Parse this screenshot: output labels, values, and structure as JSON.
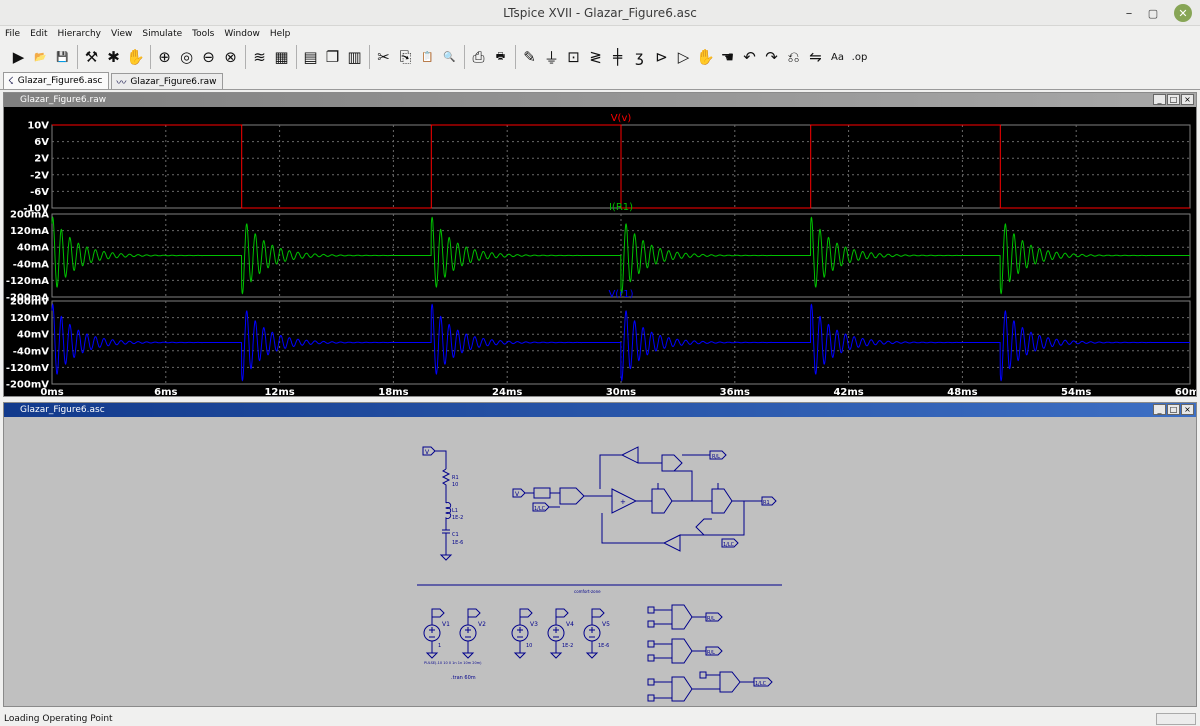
{
  "window": {
    "title": "LTspice XVII - Glazar_Figure6.asc",
    "minimize": "–",
    "maximize": "▢",
    "close": "✕"
  },
  "menu": [
    "File",
    "Edit",
    "Hierarchy",
    "View",
    "Simulate",
    "Tools",
    "Window",
    "Help"
  ],
  "toolbar": [
    {
      "icon": "run-icon",
      "glyph": "▶"
    },
    {
      "icon": "open-icon",
      "glyph": "📂"
    },
    {
      "icon": "save-icon",
      "glyph": "💾"
    },
    {
      "sep": true
    },
    {
      "icon": "control-panel-icon",
      "glyph": "⚒"
    },
    {
      "icon": "halt-icon",
      "glyph": "✱"
    },
    {
      "icon": "pan-hand-icon",
      "glyph": "✋"
    },
    {
      "sep": true
    },
    {
      "icon": "zoom-in-icon",
      "glyph": "⊕"
    },
    {
      "icon": "zoom-fit-icon",
      "glyph": "◎"
    },
    {
      "icon": "zoom-out-icon",
      "glyph": "⊖"
    },
    {
      "icon": "zoom-cancel-icon",
      "glyph": "⊗"
    },
    {
      "sep": true
    },
    {
      "icon": "autorange-icon",
      "glyph": "≋"
    },
    {
      "icon": "grid-icon",
      "glyph": "▦"
    },
    {
      "sep": true
    },
    {
      "icon": "tile-horizontal-icon",
      "glyph": "▤"
    },
    {
      "icon": "cascade-icon",
      "glyph": "❐"
    },
    {
      "icon": "tile-vertical-icon",
      "glyph": "▥"
    },
    {
      "sep": true
    },
    {
      "icon": "cut-icon",
      "glyph": "✂"
    },
    {
      "icon": "copy-icon",
      "glyph": "⎘"
    },
    {
      "icon": "paste-icon",
      "glyph": "📋"
    },
    {
      "icon": "find-icon",
      "glyph": "🔍"
    },
    {
      "sep": true
    },
    {
      "icon": "print-preview-icon",
      "glyph": "⎙"
    },
    {
      "icon": "print-icon",
      "glyph": "🖶"
    },
    {
      "sep": true
    },
    {
      "icon": "draw-wire-icon",
      "glyph": "✎"
    },
    {
      "icon": "ground-icon",
      "glyph": "⏚"
    },
    {
      "icon": "label-net-icon",
      "glyph": "⊡"
    },
    {
      "icon": "resistor-icon",
      "glyph": "≷"
    },
    {
      "icon": "capacitor-icon",
      "glyph": "╪"
    },
    {
      "icon": "inductor-icon",
      "glyph": "ʒ"
    },
    {
      "icon": "diode-icon",
      "glyph": "⊳"
    },
    {
      "icon": "component-icon",
      "glyph": "▷"
    },
    {
      "icon": "move-icon",
      "glyph": "✋"
    },
    {
      "icon": "drag-icon",
      "glyph": "☚"
    },
    {
      "icon": "undo-icon",
      "glyph": "↶"
    },
    {
      "icon": "redo-icon",
      "glyph": "↷"
    },
    {
      "icon": "rotate-icon",
      "glyph": "⎌"
    },
    {
      "icon": "mirror-icon",
      "glyph": "⇋"
    },
    {
      "icon": "text-icon",
      "glyph": "Aa"
    },
    {
      "icon": "spice-directive-icon",
      "glyph": ".op"
    }
  ],
  "tabs": [
    {
      "label": "Glazar_Figure6.asc",
      "icon": "schematic-icon",
      "glyph": "☇",
      "active": true
    },
    {
      "label": "Glazar_Figure6.raw",
      "icon": "waveform-icon",
      "glyph": "〰",
      "active": false
    }
  ],
  "wave_window": {
    "title": "Glazar_Figure6.raw"
  },
  "schematic_window": {
    "title": "Glazar_Figure6.asc"
  },
  "chart_data": [
    {
      "type": "line",
      "title": "V(v)",
      "color": "#ff0000",
      "yticks": [
        "10V",
        "6V",
        "2V",
        "-2V",
        "-6V",
        "-10V"
      ],
      "ylim": [
        -10,
        10
      ],
      "x": [
        0,
        10,
        10,
        20,
        20,
        30,
        30,
        40,
        40,
        50,
        50,
        60
      ],
      "values": [
        10,
        10,
        -10,
        -10,
        10,
        10,
        -10,
        -10,
        10,
        10,
        -10,
        -10
      ],
      "grid": true
    },
    {
      "type": "line",
      "title": "I(R1)",
      "color": "#00c000",
      "yticks": [
        "200mA",
        "120mA",
        "40mA",
        "-40mA",
        "-120mA",
        "-200mA"
      ],
      "ylim": [
        -200,
        200
      ],
      "series": [
        {
          "kind": "damped-ringing",
          "amplitude": 190,
          "period_ms": 0.45,
          "decay_ms": 1.2,
          "switch_times_ms": [
            0,
            10,
            20,
            30,
            40,
            50
          ],
          "first_sign": [
            1,
            -1,
            1,
            -1,
            1,
            -1
          ]
        }
      ],
      "grid": true
    },
    {
      "type": "line",
      "title": "V(r1)",
      "color": "#0000ff",
      "yticks": [
        "200mV",
        "120mV",
        "40mV",
        "-40mV",
        "-120mV",
        "-200mV"
      ],
      "ylim": [
        -200,
        200
      ],
      "series": [
        {
          "kind": "damped-ringing",
          "amplitude": 190,
          "period_ms": 0.45,
          "decay_ms": 1.2,
          "switch_times_ms": [
            0,
            10,
            20,
            30,
            40,
            50
          ],
          "first_sign": [
            1,
            -1,
            1,
            -1,
            1,
            -1
          ]
        }
      ],
      "xticks": [
        "0ms",
        "6ms",
        "12ms",
        "18ms",
        "24ms",
        "30ms",
        "36ms",
        "42ms",
        "48ms",
        "54ms",
        "60ms"
      ],
      "xlim": [
        0,
        60
      ],
      "grid": true
    }
  ],
  "schematic": {
    "net_v": "V",
    "r1": {
      "name": "R1",
      "value": "10"
    },
    "l1": {
      "name": "L1",
      "value": "1E-2"
    },
    "c1": {
      "name": "C1",
      "value": "1E-6"
    },
    "net_rl": "R/L",
    "net_1lc": "1/LC",
    "sources": [
      {
        "name": "V1",
        "value": "1"
      },
      {
        "name": "V2",
        "value": ""
      },
      {
        "name": "V3",
        "value": "10"
      },
      {
        "name": "V4",
        "value": "1E-2"
      },
      {
        "name": "V5",
        "value": "1E-6"
      }
    ],
    "pulse_text": "PULSE(-10 10 0 1n 1n 10m 20m)",
    "tran": ".tran 60m",
    "divider_label": "comfort-zone",
    "out_label": "R1"
  },
  "status": {
    "text": "Loading Operating Point"
  }
}
